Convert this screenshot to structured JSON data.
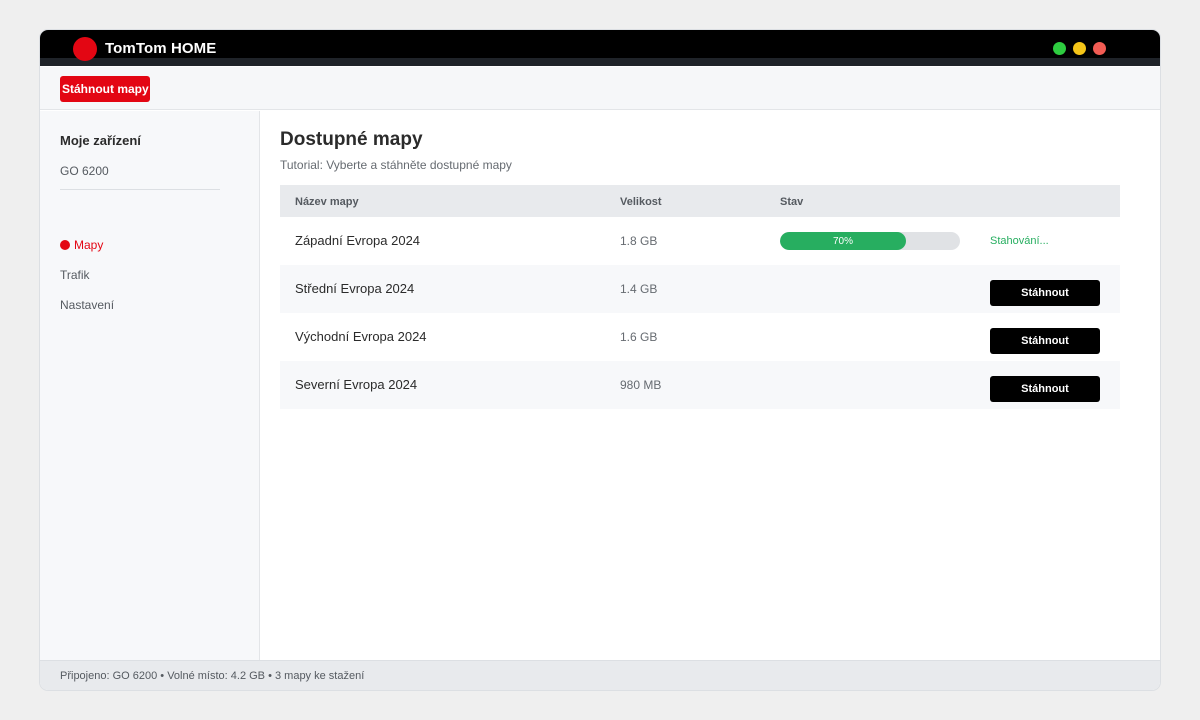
{
  "app": {
    "title": "TomTom HOME"
  },
  "toolbar": {
    "download_maps_label": "Stáhnout mapy"
  },
  "sidebar": {
    "device_heading": "Moje zařízení",
    "device_name": "GO 6200",
    "items": [
      {
        "label": "Mapy",
        "active": true
      },
      {
        "label": "Trafik",
        "active": false
      },
      {
        "label": "Nastavení",
        "active": false
      }
    ]
  },
  "main": {
    "title": "Dostupné mapy",
    "subtitle": "Tutorial: Vyberte a stáhněte dostupné mapy",
    "columns": [
      "Název mapy",
      "Velikost",
      "Stav"
    ],
    "rows": [
      {
        "name": "Západní Evropa 2024",
        "size": "1.8 GB",
        "progress": 70,
        "progress_label": "70%",
        "status": "Stahování..."
      },
      {
        "name": "Střední Evropa 2024",
        "size": "1.4 GB",
        "action": "Stáhnout"
      },
      {
        "name": "Východní Evropa 2024",
        "size": "1.6 GB",
        "action": "Stáhnout"
      },
      {
        "name": "Severní Evropa 2024",
        "size": "980 MB",
        "action": "Stáhnout"
      }
    ]
  },
  "statusbar": {
    "text": "Připojeno: GO 6200 • Volné místo: 4.2 GB • 3 mapy ke stažení"
  },
  "colors": {
    "brand": "#e30613",
    "progress": "#27ae60",
    "title_bar": "#000000"
  },
  "icons": {
    "logo": "tomtom-logo-icon",
    "active_nav": "active-dot-icon"
  }
}
